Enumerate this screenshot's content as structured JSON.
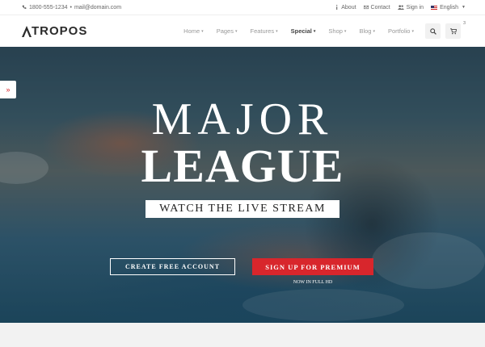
{
  "topbar": {
    "phone": "1800-555-1234",
    "separator": "•",
    "email": "mail@domain.com",
    "about": "About",
    "contact": "Contact",
    "signin": "Sign in",
    "language": "English"
  },
  "header": {
    "logo_text": "TROPOS",
    "nav": [
      {
        "label": "Home"
      },
      {
        "label": "Pages"
      },
      {
        "label": "Features"
      },
      {
        "label": "Special"
      },
      {
        "label": "Shop"
      },
      {
        "label": "Blog"
      },
      {
        "label": "Portfolio"
      }
    ],
    "cart_count": "3"
  },
  "hero": {
    "title_line1": "MAJOR",
    "title_line2": "LEAGUE",
    "subtitle": "WATCH THE LIVE STREAM",
    "btn_create": "CREATE FREE ACCOUNT",
    "btn_premium": "SIGN UP FOR PREMIUM",
    "note": "NOW IN FULL HD",
    "side_tab_icon": "»"
  },
  "colors": {
    "accent": "#d8262c",
    "text_dark": "#2b2b2b",
    "nav_muted": "#999999"
  },
  "icons": {
    "phone": "phone-icon",
    "users": "users-icon",
    "info": "info-icon",
    "mail": "mail-icon",
    "search": "search-icon",
    "cart": "cart-icon",
    "flag": "us-flag-icon"
  }
}
